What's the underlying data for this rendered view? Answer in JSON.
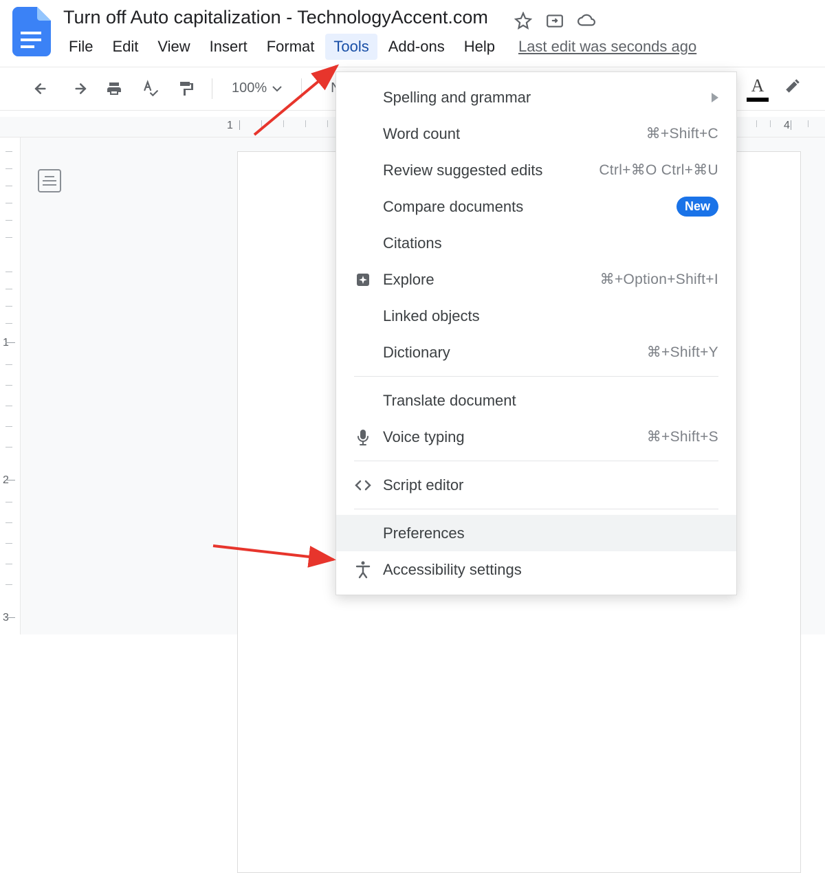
{
  "doc": {
    "title": "Turn off Auto capitalization - TechnologyAccent.com",
    "last_edit": "Last edit was seconds ago"
  },
  "menubar": {
    "items": [
      "File",
      "Edit",
      "View",
      "Insert",
      "Format",
      "Tools",
      "Add-ons",
      "Help"
    ],
    "active_index": 5
  },
  "toolbar": {
    "zoom": "100%",
    "paragraph_style": "Normal"
  },
  "ruler": {
    "h_numbers": {
      "one": "1",
      "four": "4"
    },
    "v_numbers": {
      "one": "1",
      "two": "2",
      "three": "3"
    }
  },
  "tools_menu": {
    "items": [
      {
        "label": "Spelling and grammar",
        "icon": "",
        "shortcut": "",
        "submenu": true
      },
      {
        "label": "Word count",
        "icon": "",
        "shortcut": "⌘+Shift+C"
      },
      {
        "label": "Review suggested edits",
        "icon": "",
        "shortcut": "Ctrl+⌘O Ctrl+⌘U"
      },
      {
        "label": "Compare documents",
        "icon": "",
        "badge": "New"
      },
      {
        "label": "Citations",
        "icon": ""
      },
      {
        "label": "Explore",
        "icon": "explore",
        "shortcut": "⌘+Option+Shift+I"
      },
      {
        "label": "Linked objects",
        "icon": ""
      },
      {
        "label": "Dictionary",
        "icon": "",
        "shortcut": "⌘+Shift+Y"
      },
      {
        "sep": true
      },
      {
        "label": "Translate document",
        "icon": ""
      },
      {
        "label": "Voice typing",
        "icon": "mic",
        "shortcut": "⌘+Shift+S"
      },
      {
        "sep": true
      },
      {
        "label": "Script editor",
        "icon": "code"
      },
      {
        "sep": true
      },
      {
        "label": "Preferences",
        "icon": "",
        "hovered": true
      },
      {
        "label": "Accessibility settings",
        "icon": "accessibility"
      }
    ],
    "badge_label": "New"
  }
}
